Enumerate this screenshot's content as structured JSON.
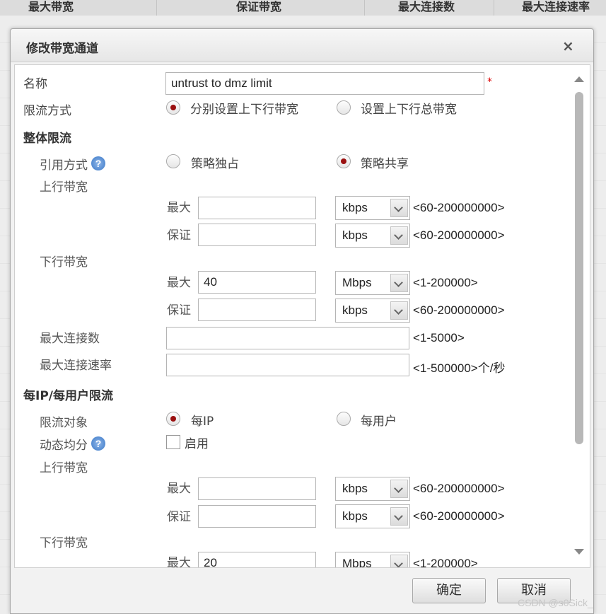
{
  "background_table": {
    "columns": [
      "最大带宽",
      "保证带宽",
      "最大连接数",
      "最大连接速率"
    ]
  },
  "dialog": {
    "title": "修改带宽通道",
    "close_glyph": "×",
    "name_label": "名称",
    "name_value": "untrust to dmz limit",
    "required_mark": "*",
    "limit_mode_label": "限流方式",
    "limit_mode_options": [
      "分别设置上下行带宽",
      "设置上下行总带宽"
    ],
    "limit_mode_selected": "分别设置上下行带宽",
    "overall": {
      "section_title": "整体限流",
      "ref_mode_label": "引用方式",
      "ref_mode_options": [
        "策略独占",
        "策略共享"
      ],
      "ref_mode_selected": "策略共享",
      "upstream_label": "上行带宽",
      "upstream": {
        "max_label": "最大",
        "max_value": "",
        "max_unit": "kbps",
        "max_range": "<60-200000000>",
        "guarantee_label": "保证",
        "guarantee_value": "",
        "guarantee_unit": "kbps",
        "guarantee_range": "<60-200000000>"
      },
      "downstream_label": "下行带宽",
      "downstream": {
        "max_label": "最大",
        "max_value": "40",
        "max_unit": "Mbps",
        "max_range": "<1-200000>",
        "guarantee_label": "保证",
        "guarantee_value": "",
        "guarantee_unit": "kbps",
        "guarantee_range": "<60-200000000>"
      },
      "max_conn_label": "最大连接数",
      "max_conn_value": "",
      "max_conn_range": "<1-5000>",
      "max_conn_rate_label": "最大连接速率",
      "max_conn_rate_value": "",
      "max_conn_rate_range": "<1-500000>个/秒"
    },
    "per_ip": {
      "section_title": "每IP/每用户限流",
      "target_label": "限流对象",
      "target_options": [
        "每IP",
        "每用户"
      ],
      "target_selected": "每IP",
      "dynamic_label": "动态均分",
      "dynamic_checkbox_label": "启用",
      "dynamic_enabled": false,
      "upstream_label": "上行带宽",
      "upstream": {
        "max_label": "最大",
        "max_value": "",
        "max_unit": "kbps",
        "max_range": "<60-200000000>",
        "guarantee_label": "保证",
        "guarantee_value": "",
        "guarantee_unit": "kbps",
        "guarantee_range": "<60-200000000>"
      },
      "downstream_label": "下行带宽",
      "downstream": {
        "max_label": "最大",
        "max_value": "20",
        "max_unit": "Mbps",
        "max_range": "<1-200000>"
      }
    },
    "help_glyph": "?",
    "ok_label": "确定",
    "cancel_label": "取消"
  },
  "watermark": "CSDN @s0Sick_",
  "colors": {
    "radio_selected": "#9a1010",
    "required": "#dd0000",
    "help_icon": "#3a78c8"
  }
}
